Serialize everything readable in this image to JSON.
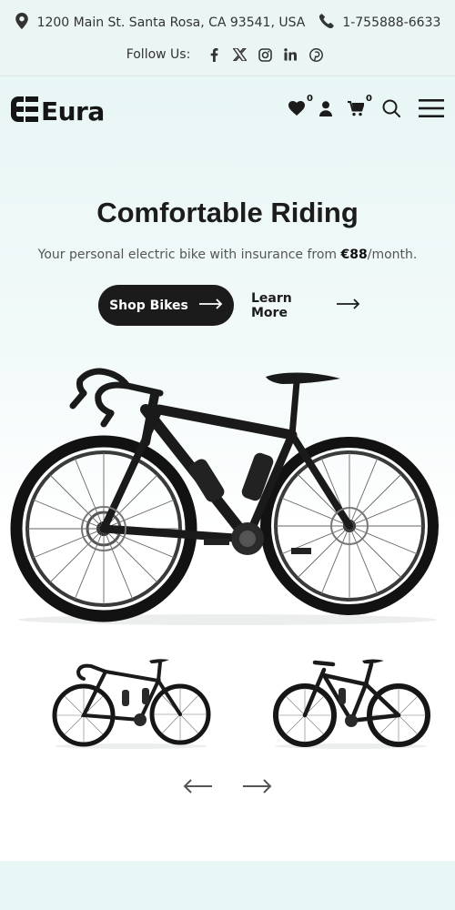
{
  "topbar": {
    "address": "1200 Main St. Santa Rosa, CA 93541, USA",
    "phone": "1-755888-6633",
    "follow_label": "Follow Us:",
    "social_icons": [
      "facebook-icon",
      "x-icon",
      "instagram-icon",
      "linkedin-icon",
      "pinterest-icon"
    ]
  },
  "header": {
    "logo_text": "Eura",
    "wishlist_count": "0",
    "cart_count": "0"
  },
  "hero": {
    "title": "Comfortable Riding",
    "subtitle_prefix": "Your personal electric bike with insurance from ",
    "subtitle_price": "€88",
    "subtitle_suffix": "/month.",
    "shop_button": "Shop Bikes",
    "more_button": "Learn More"
  },
  "colors": {
    "topbar_bg": "#eaf5f4",
    "accent_dark": "#1b1b1b",
    "hero_bg": "#e8f6f5"
  }
}
